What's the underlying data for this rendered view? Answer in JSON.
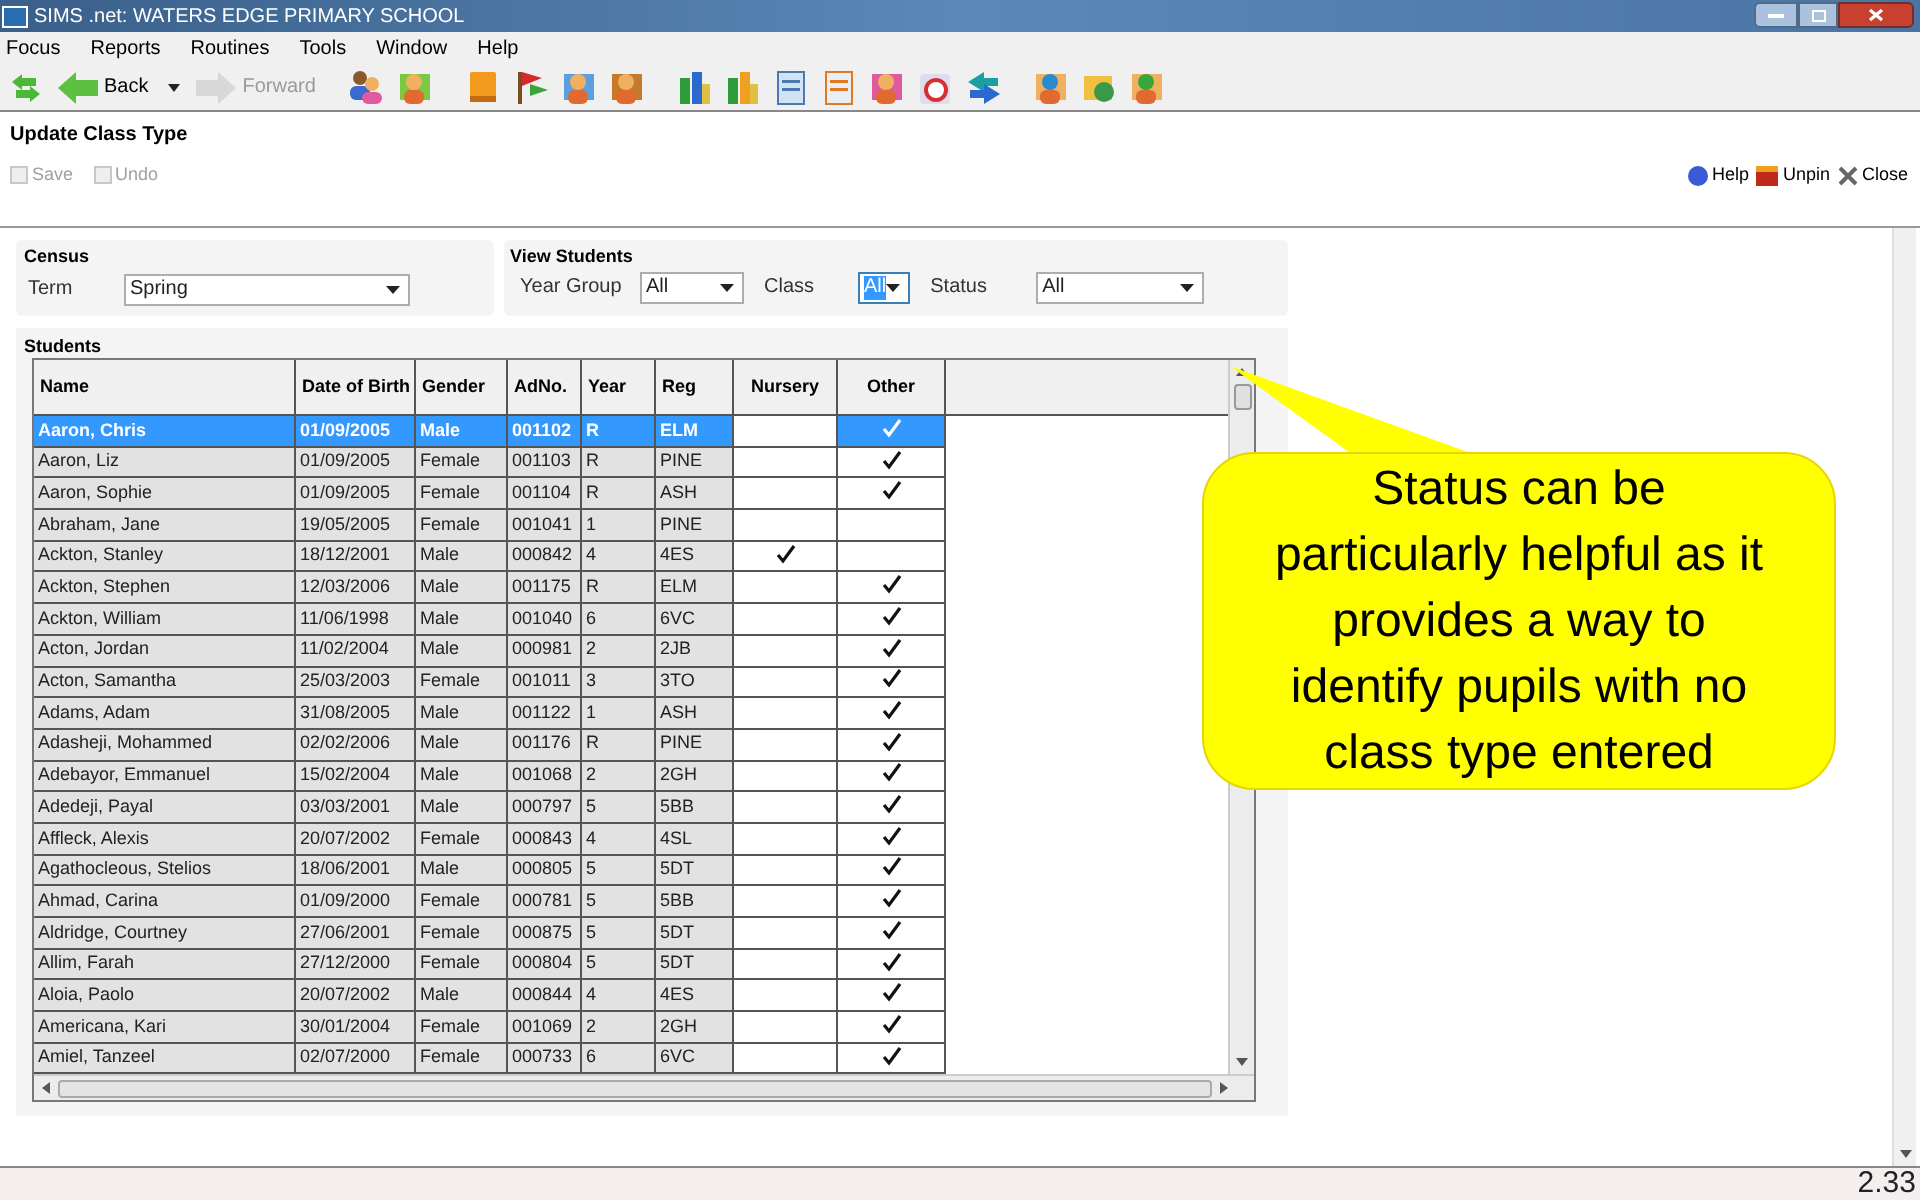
{
  "window": {
    "title": "SIMS .net: WATERS EDGE PRIMARY SCHOOL"
  },
  "menu": [
    "Focus",
    "Reports",
    "Routines",
    "Tools",
    "Window",
    "Help"
  ],
  "toolbar": {
    "back": "Back",
    "forward": {
      "label": "Forward",
      "disabled": true
    }
  },
  "panel": {
    "title": "Update Class Type",
    "actions": [
      {
        "label": "Save",
        "disabled": true
      },
      {
        "label": "Undo",
        "disabled": true
      }
    ],
    "right_actions": [
      {
        "kind": "help",
        "label": "Help"
      },
      {
        "kind": "unpin",
        "label": "Unpin"
      },
      {
        "kind": "close",
        "label": "Close"
      }
    ]
  },
  "census": {
    "title": "Census",
    "fields": [
      {
        "label": "Term",
        "value": "Spring",
        "focused": false
      }
    ]
  },
  "view_students": {
    "title": "View Students",
    "fields": [
      {
        "label": "Year Group",
        "value": "All",
        "focused": false
      },
      {
        "label": "Class",
        "value": "All",
        "focused": true
      },
      {
        "label": "Status",
        "value": "All",
        "focused": false
      }
    ]
  },
  "students": {
    "title": "Students",
    "columns": [
      "Name",
      "Date of Birth",
      "Gender",
      "AdNo.",
      "Year",
      "Reg",
      "Nursery",
      "Other"
    ],
    "rows": [
      {
        "name": "Aaron, Chris",
        "dob": "01/09/2005",
        "gender": "Male",
        "adno": "001102",
        "year": "R",
        "reg": "ELM",
        "nursery": false,
        "other": true,
        "selected": true
      },
      {
        "name": "Aaron, Liz",
        "dob": "01/09/2005",
        "gender": "Female",
        "adno": "001103",
        "year": "R",
        "reg": "PINE",
        "nursery": false,
        "other": true,
        "selected": false
      },
      {
        "name": "Aaron, Sophie",
        "dob": "01/09/2005",
        "gender": "Female",
        "adno": "001104",
        "year": "R",
        "reg": "ASH",
        "nursery": false,
        "other": true,
        "selected": false
      },
      {
        "name": "Abraham, Jane",
        "dob": "19/05/2005",
        "gender": "Female",
        "adno": "001041",
        "year": "1",
        "reg": "PINE",
        "nursery": false,
        "other": false,
        "selected": false
      },
      {
        "name": "Ackton, Stanley",
        "dob": "18/12/2001",
        "gender": "Male",
        "adno": "000842",
        "year": "4",
        "reg": "4ES",
        "nursery": true,
        "other": false,
        "selected": false
      },
      {
        "name": "Ackton, Stephen",
        "dob": "12/03/2006",
        "gender": "Male",
        "adno": "001175",
        "year": "R",
        "reg": "ELM",
        "nursery": false,
        "other": true,
        "selected": false
      },
      {
        "name": "Ackton, William",
        "dob": "11/06/1998",
        "gender": "Male",
        "adno": "001040",
        "year": "6",
        "reg": "6VC",
        "nursery": false,
        "other": true,
        "selected": false
      },
      {
        "name": "Acton, Jordan",
        "dob": "11/02/2004",
        "gender": "Male",
        "adno": "000981",
        "year": "2",
        "reg": "2JB",
        "nursery": false,
        "other": true,
        "selected": false
      },
      {
        "name": "Acton, Samantha",
        "dob": "25/03/2003",
        "gender": "Female",
        "adno": "001011",
        "year": "3",
        "reg": "3TO",
        "nursery": false,
        "other": true,
        "selected": false
      },
      {
        "name": "Adams, Adam",
        "dob": "31/08/2005",
        "gender": "Male",
        "adno": "001122",
        "year": "1",
        "reg": "ASH",
        "nursery": false,
        "other": true,
        "selected": false
      },
      {
        "name": "Adasheji, Mohammed",
        "dob": "02/02/2006",
        "gender": "Male",
        "adno": "001176",
        "year": "R",
        "reg": "PINE",
        "nursery": false,
        "other": true,
        "selected": false
      },
      {
        "name": "Adebayor, Emmanuel",
        "dob": "15/02/2004",
        "gender": "Male",
        "adno": "001068",
        "year": "2",
        "reg": "2GH",
        "nursery": false,
        "other": true,
        "selected": false
      },
      {
        "name": "Adedeji, Payal",
        "dob": "03/03/2001",
        "gender": "Male",
        "adno": "000797",
        "year": "5",
        "reg": "5BB",
        "nursery": false,
        "other": true,
        "selected": false
      },
      {
        "name": "Affleck, Alexis",
        "dob": "20/07/2002",
        "gender": "Female",
        "adno": "000843",
        "year": "4",
        "reg": "4SL",
        "nursery": false,
        "other": true,
        "selected": false
      },
      {
        "name": "Agathocleous, Stelios",
        "dob": "18/06/2001",
        "gender": "Male",
        "adno": "000805",
        "year": "5",
        "reg": "5DT",
        "nursery": false,
        "other": true,
        "selected": false
      },
      {
        "name": "Ahmad, Carina",
        "dob": "01/09/2000",
        "gender": "Female",
        "adno": "000781",
        "year": "5",
        "reg": "5BB",
        "nursery": false,
        "other": true,
        "selected": false
      },
      {
        "name": "Aldridge, Courtney",
        "dob": "27/06/2001",
        "gender": "Female",
        "adno": "000875",
        "year": "5",
        "reg": "5DT",
        "nursery": false,
        "other": true,
        "selected": false
      },
      {
        "name": "Allim, Farah",
        "dob": "27/12/2000",
        "gender": "Female",
        "adno": "000804",
        "year": "5",
        "reg": "5DT",
        "nursery": false,
        "other": true,
        "selected": false
      },
      {
        "name": "Aloia, Paolo",
        "dob": "20/07/2002",
        "gender": "Male",
        "adno": "000844",
        "year": "4",
        "reg": "4ES",
        "nursery": false,
        "other": true,
        "selected": false
      },
      {
        "name": "Americana, Kari",
        "dob": "30/01/2004",
        "gender": "Female",
        "adno": "001069",
        "year": "2",
        "reg": "2GH",
        "nursery": false,
        "other": true,
        "selected": false
      },
      {
        "name": "Amiel, Tanzeel",
        "dob": "02/07/2000",
        "gender": "Female",
        "adno": "000733",
        "year": "6",
        "reg": "6VC",
        "nursery": false,
        "other": true,
        "selected": false
      }
    ]
  },
  "callout": {
    "lines": [
      "Status can be",
      "particularly helpful as it",
      "provides a way to",
      "identify pupils with no",
      "class type entered"
    ]
  },
  "status_bar": {
    "text": "2.33"
  }
}
